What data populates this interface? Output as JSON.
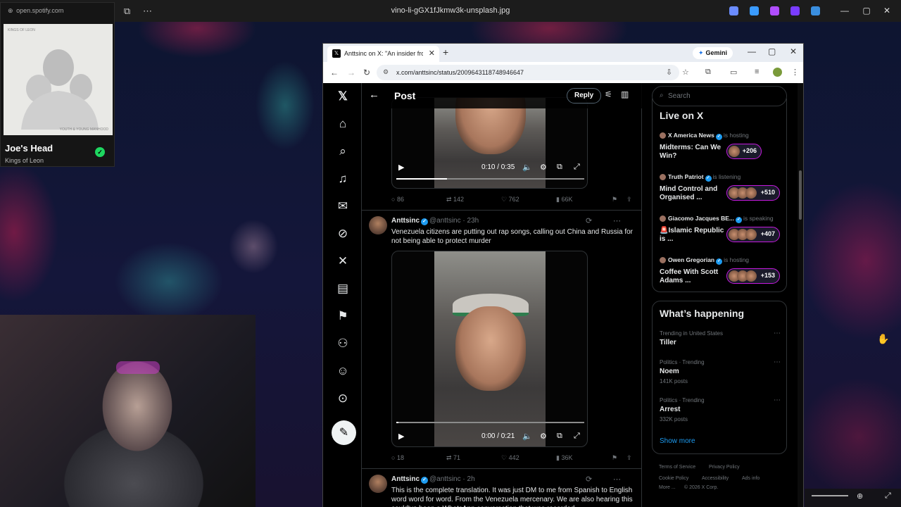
{
  "titlebar": {
    "title": "vino-li-gGX1fJkmw3k-unsplash.jpg",
    "left_icons": [
      "picture-in-picture-icon",
      "more-icon"
    ],
    "win_min": "—",
    "win_max": "▢",
    "win_close": "✕"
  },
  "spotify": {
    "url": "open.spotify.com",
    "cover_top": "KINGS OF LEON",
    "cover_bottom": "YOUTH & YOUNG MANHOOD",
    "song": "Joe's Head",
    "artist": "Kings of Leon"
  },
  "browser": {
    "tab_title": "Anttsinc on X: \"An insider from",
    "gemini_label": "Gemini",
    "url": "x.com/anttsinc/status/2009643118748946647"
  },
  "x": {
    "header_title": "Post",
    "reply_label": "Reply",
    "video1": {
      "time": "0:10 / 0:35",
      "progress": 0.27
    },
    "tweet1_actions": {
      "replies": "86",
      "reposts": "142",
      "likes": "762",
      "views": "66K"
    },
    "tweet2": {
      "name": "Anttsinc",
      "handle": "@anttsinc · 23h",
      "text": "Venezuela citizens are putting out rap songs, calling out China and Russia for not being able to protect murder",
      "video_time": "0:00 / 0:21",
      "video_progress": 0.01,
      "actions": {
        "replies": "18",
        "reposts": "71",
        "likes": "442",
        "views": "36K"
      }
    },
    "tweet3": {
      "name": "Anttsinc",
      "handle": "@anttsinc · 2h",
      "text": "This is the complete translation. It was just DM to me from Spanish to English word word for word. From the Venezuela mercenary. We are also hearing this could've been a WhatsApp conversation that was recorded"
    },
    "search_placeholder": "Search",
    "live": {
      "heading": "Live on X",
      "items": [
        {
          "host": "X America News",
          "status": "is hosting",
          "title": "Midterms: Can We Win?",
          "count": "+206"
        },
        {
          "host": "Truth Patriot",
          "status": "is listening",
          "title": "Mind Control and Organised ...",
          "count": "+510"
        },
        {
          "host": "Giacomo Jacques BE...",
          "status": "is speaking",
          "title": "🚨Islamic Republic is ...",
          "count": "+407"
        },
        {
          "host": "Owen Gregorian",
          "status": "is hosting",
          "title": "Coffee With Scott Adams ...",
          "count": "+153"
        }
      ]
    },
    "trends": {
      "heading": "What’s happening",
      "items": [
        {
          "meta": "Trending in United States",
          "name": "Tiller",
          "count": ""
        },
        {
          "meta": "Politics · Trending",
          "name": "Noem",
          "count": "141K posts"
        },
        {
          "meta": "Politics · Trending",
          "name": "Arrest",
          "count": "332K posts"
        }
      ],
      "show_more": "Show more"
    },
    "footer": {
      "terms": "Terms of Service",
      "privacy": "Privacy Policy",
      "cookie": "Cookie Policy",
      "access": "Accessibility",
      "ads": "Ads info",
      "more": "More ...",
      "copyright": "© 2026 X Corp."
    }
  }
}
